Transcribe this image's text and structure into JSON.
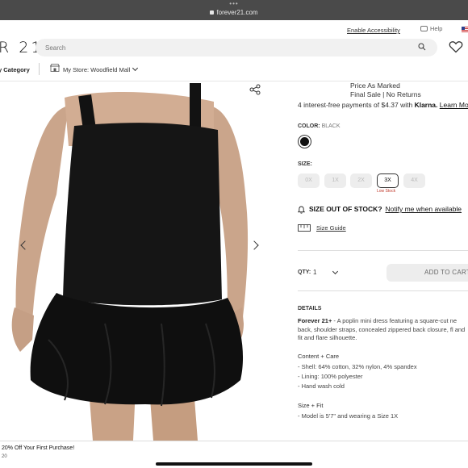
{
  "browser": {
    "url": "forever21.com"
  },
  "utility": {
    "accessibility": "Enable Accessibility",
    "help": "Help"
  },
  "header": {
    "logo": "R 21",
    "search_placeholder": "Search"
  },
  "subnav": {
    "category": "y Category",
    "store": "My Store: Woodfield Mall"
  },
  "product": {
    "price_marked": "Price As Marked",
    "final_sale": "Final Sale | No Returns",
    "klarna_text": "4 interest-free payments of $4.37 with ",
    "klarna_brand": "Klarna.",
    "klarna_link": "Learn Mo",
    "color_label": "COLOR:",
    "color_value": "BLACK",
    "size_label": "SIZE:",
    "sizes": [
      "0X",
      "1X",
      "2X",
      "3X",
      "4X"
    ],
    "low_stock": "Low Stock",
    "oos_label": "SIZE OUT OF STOCK?",
    "notify": "Notify me when available",
    "size_guide": "Size Guide",
    "qty_label": "QTY:",
    "qty_value": "1",
    "add_to_cart": "ADD TO CART",
    "details_label": "DETAILS",
    "desc_brand": "Forever 21+",
    "desc_text": " - A poplin mini dress featuring a square-cut ne back, shoulder straps, concealed zippered back closure, fl and fit and flare silhouette.",
    "content_title": "Content + Care",
    "content_lines": [
      "- Shell: 64% cotton, 32% nylon, 4% spandex",
      "- Lining: 100% polyester",
      "- Hand wash cold"
    ],
    "fit_title": "Size + Fit",
    "fit_lines": [
      "- Model is 5'7\" and wearing a Size 1X"
    ]
  },
  "promo": {
    "text": "20% Off Your First Purchase!",
    "code": "20"
  },
  "colors": {
    "accent": "#111111",
    "low_stock": "#c0392b"
  }
}
